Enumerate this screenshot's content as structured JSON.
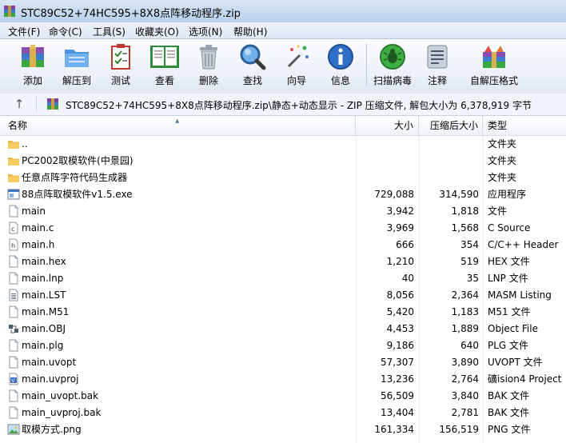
{
  "window": {
    "title": "STC89C52+74HC595+8X8点阵移动程序.zip"
  },
  "menu": [
    "文件(F)",
    "命令(C)",
    "工具(S)",
    "收藏夹(O)",
    "选项(N)",
    "帮助(H)"
  ],
  "toolbar": [
    {
      "label": "添加",
      "icon": "add-archive-icon"
    },
    {
      "label": "解压到",
      "icon": "extract-to-icon"
    },
    {
      "label": "测试",
      "icon": "test-icon"
    },
    {
      "label": "查看",
      "icon": "view-book-icon"
    },
    {
      "label": "删除",
      "icon": "delete-trash-icon"
    },
    {
      "label": "查找",
      "icon": "find-magnifier-icon"
    },
    {
      "label": "向导",
      "icon": "wizard-wand-icon"
    },
    {
      "label": "信息",
      "icon": "info-icon"
    },
    {
      "label": "扫描病毒",
      "icon": "virus-scan-icon"
    },
    {
      "label": "注释",
      "icon": "comment-icon"
    },
    {
      "label": "自解压格式",
      "icon": "sfx-icon"
    }
  ],
  "pathbar": {
    "text": "STC89C52+74HC595+8X8点阵移动程序.zip\\静态+动态显示 - ZIP 压缩文件, 解包大小为 6,378,919 字节"
  },
  "columns": {
    "name": "名称",
    "size": "大小",
    "packed": "压缩后大小",
    "type": "类型"
  },
  "files": [
    {
      "name": "..",
      "size": "",
      "packed": "",
      "type": "文件夹",
      "icon": "folder"
    },
    {
      "name": "PC2002取模软件(中景园)",
      "size": "",
      "packed": "",
      "type": "文件夹",
      "icon": "folder"
    },
    {
      "name": "任意点阵字符代码生成器",
      "size": "",
      "packed": "",
      "type": "文件夹",
      "icon": "folder"
    },
    {
      "name": "88点阵取模软件v1.5.exe",
      "size": "729,088",
      "packed": "314,590",
      "type": "应用程序",
      "icon": "exe"
    },
    {
      "name": "main",
      "size": "3,942",
      "packed": "1,818",
      "type": "文件",
      "icon": "file"
    },
    {
      "name": "main.c",
      "size": "3,969",
      "packed": "1,568",
      "type": "C Source",
      "icon": "c"
    },
    {
      "name": "main.h",
      "size": "666",
      "packed": "354",
      "type": "C/C++ Header",
      "icon": "h"
    },
    {
      "name": "main.hex",
      "size": "1,210",
      "packed": "519",
      "type": "HEX 文件",
      "icon": "file"
    },
    {
      "name": "main.lnp",
      "size": "40",
      "packed": "35",
      "type": "LNP 文件",
      "icon": "file"
    },
    {
      "name": "main.LST",
      "size": "8,056",
      "packed": "2,364",
      "type": "MASM Listing",
      "icon": "lines"
    },
    {
      "name": "main.M51",
      "size": "5,420",
      "packed": "1,183",
      "type": "M51 文件",
      "icon": "file"
    },
    {
      "name": "main.OBJ",
      "size": "4,453",
      "packed": "1,889",
      "type": "Object File",
      "icon": "obj"
    },
    {
      "name": "main.plg",
      "size": "9,186",
      "packed": "640",
      "type": "PLG 文件",
      "icon": "file"
    },
    {
      "name": "main.uvopt",
      "size": "57,307",
      "packed": "3,890",
      "type": "UVOPT 文件",
      "icon": "file"
    },
    {
      "name": "main.uvproj",
      "size": "13,236",
      "type": "礦ision4 Project",
      "packed": "2,764",
      "icon": "uv"
    },
    {
      "name": "main_uvopt.bak",
      "size": "56,509",
      "packed": "3,840",
      "type": "BAK 文件",
      "icon": "file"
    },
    {
      "name": "main_uvproj.bak",
      "size": "13,404",
      "packed": "2,781",
      "type": "BAK 文件",
      "icon": "file"
    },
    {
      "name": "取模方式.png",
      "size": "161,334",
      "packed": "156,519",
      "type": "PNG 文件",
      "icon": "png"
    }
  ]
}
